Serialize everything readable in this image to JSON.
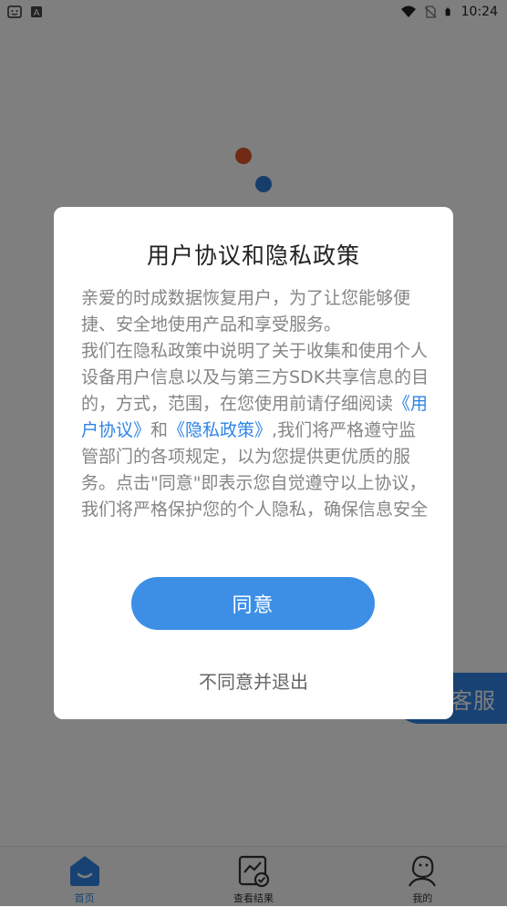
{
  "status_bar": {
    "time": "10:24",
    "left_icons": [
      "face-icon",
      "a-badge-icon"
    ],
    "right_icons": [
      "wifi-icon",
      "no-sim-icon",
      "battery-icon"
    ]
  },
  "service_button": {
    "label": "客服"
  },
  "bottom_nav": {
    "items": [
      {
        "label": "首页",
        "icon": "home-icon",
        "active": true
      },
      {
        "label": "查看结果",
        "icon": "results-chart-icon",
        "active": false
      },
      {
        "label": "我的",
        "icon": "profile-icon",
        "active": false
      }
    ]
  },
  "dialog": {
    "title": "用户协议和隐私政策",
    "para1": "亲爱的时成数据恢复用户，为了让您能够便捷、安全地使用产品和享受服务。",
    "para2_pre": "我们在隐私政策中说明了关于收集和使用个人设备用户信息以及与第三方SDK共享信息的目的，方式，范围，在您使用前请仔细阅读",
    "link_user_agreement": "《用户协议》",
    "and_text": "和",
    "link_privacy_policy": "《隐私政策》",
    "para2_post": ",我们将严格遵守监管部门的各项规定，以为您提供更优质的服务。点击\"同意\"即表示您自觉遵守以上协议，我们将严格保护您的个人隐私，确保信息安全",
    "agree_label": "同意",
    "disagree_label": "不同意并退出"
  },
  "colors": {
    "accent": "#2e84e6",
    "overlay": "rgba(0,0,0,0.5)",
    "dot_red": "#e0542a",
    "dot_blue": "#2f7ad6"
  }
}
